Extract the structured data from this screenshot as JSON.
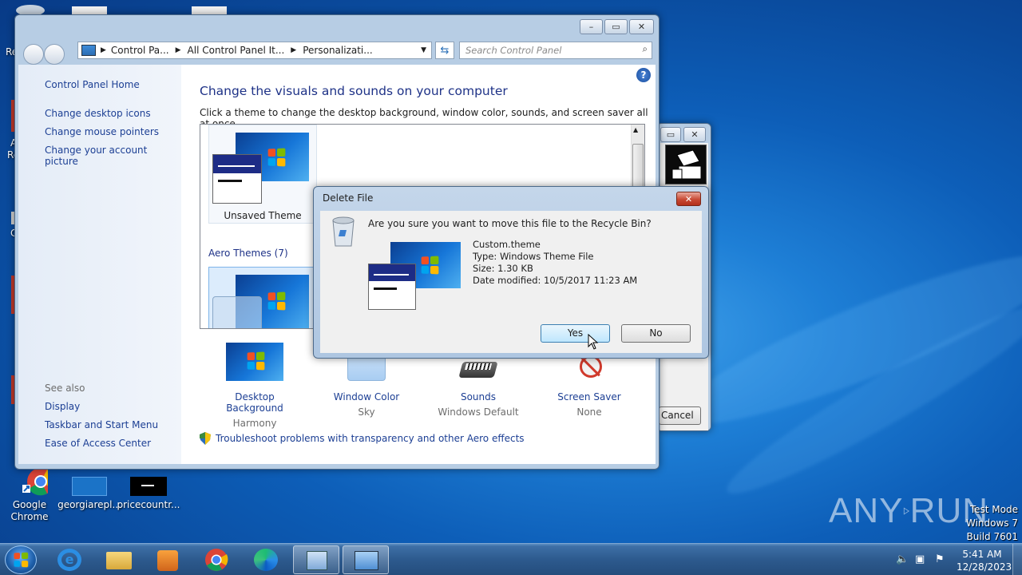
{
  "desktop": {
    "icons": [
      {
        "label": "Google Chrome"
      },
      {
        "label": "georgiarepl..."
      },
      {
        "label": "pricecountr..."
      }
    ],
    "partial_labels": {
      "re": "Re",
      "a": "A",
      "re2": "Re",
      "c": "C"
    },
    "watermark": {
      "brand_left": "ANY",
      "brand_right": "RUN",
      "line1": "Test Mode",
      "line2": "Windows 7",
      "line3": "Build 7601"
    }
  },
  "personalization": {
    "breadcrumb": [
      "Control Pa...",
      "All Control Panel It...",
      "Personalizati..."
    ],
    "search_placeholder": "Search Control Panel",
    "sidebar": {
      "home": "Control Panel Home",
      "links": [
        "Change desktop icons",
        "Change mouse pointers",
        "Change your account picture"
      ],
      "see_also_title": "See also",
      "see_also": [
        "Display",
        "Taskbar and Start Menu",
        "Ease of Access Center"
      ]
    },
    "title": "Change the visuals and sounds on your computer",
    "subtitle": "Click a theme to change the desktop background, window color, sounds, and screen saver all at once.",
    "unsaved_theme": "Unsaved Theme",
    "aero_group": "Aero Themes (7)",
    "settings": [
      {
        "label": "Desktop Background",
        "value": "Harmony"
      },
      {
        "label": "Window Color",
        "value": "Sky"
      },
      {
        "label": "Sounds",
        "value": "Windows Default"
      },
      {
        "label": "Screen Saver",
        "value": "None"
      }
    ],
    "troubleshoot": "Troubleshoot problems with transparency and other Aero effects"
  },
  "background_dialog": {
    "cancel": "Cancel"
  },
  "delete_dialog": {
    "title": "Delete File",
    "question": "Are you sure you want to move this file to the Recycle Bin?",
    "file_name": "Custom.theme",
    "file_type": "Type: Windows Theme File",
    "file_size": "Size: 1.30 KB",
    "file_date": "Date modified: 10/5/2017 11:23 AM",
    "yes": "Yes",
    "no": "No"
  },
  "taskbar": {
    "time": "5:41 AM",
    "date": "12/28/2023"
  },
  "colors": {
    "link": "#1c3f94",
    "title_blue": "#1e3287",
    "close_red": "#c84a34"
  }
}
